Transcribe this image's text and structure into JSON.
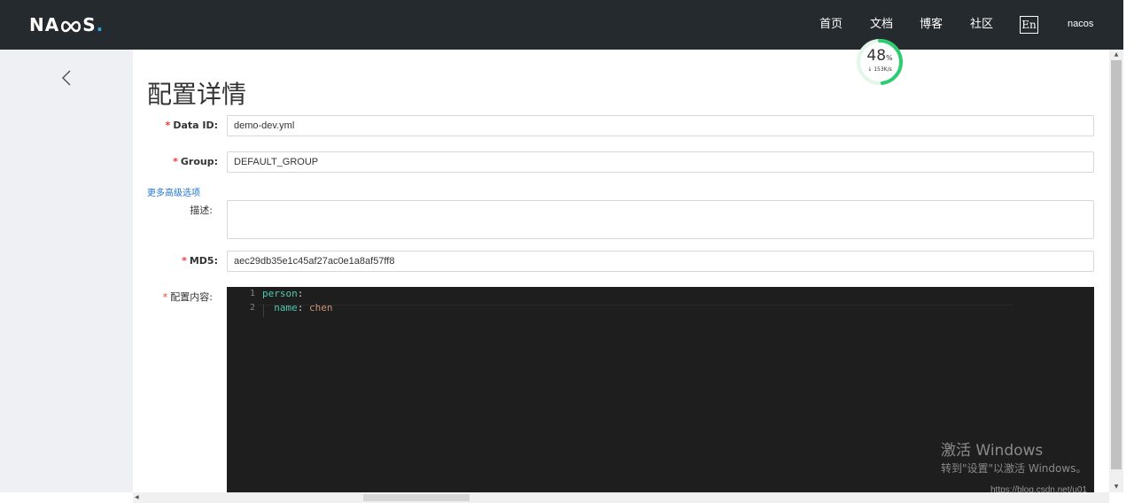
{
  "nav": {
    "logo_pre": "NA",
    "logo_post": "S",
    "logo_dot": ".",
    "items": [
      {
        "label": "首页"
      },
      {
        "label": "文档"
      },
      {
        "label": "博客"
      },
      {
        "label": "社区"
      }
    ],
    "lang": "En",
    "user": "nacos"
  },
  "page": {
    "title": "配置详情"
  },
  "form": {
    "data_id_label": "Data ID:",
    "data_id_value": "demo-dev.yml",
    "group_label": "Group:",
    "group_value": "DEFAULT_GROUP",
    "advanced_link": "更多高级选项",
    "desc_label": "描述:",
    "desc_value": "",
    "md5_label": "MD5:",
    "md5_value": "aec29db35e1c45af27ac0e1a8af57ff8",
    "content_label": "配置内容:",
    "required_mark": "*"
  },
  "editor": {
    "lines": [
      {
        "num": "1",
        "key": "person",
        "sep": ":",
        "value": ""
      },
      {
        "num": "2",
        "key": "  name",
        "sep": ": ",
        "value": "chen"
      }
    ]
  },
  "network_widget": {
    "percent": "48",
    "percent_unit": "%",
    "speed": "↓ 153K/s",
    "progress": 0.48
  },
  "watermark": {
    "title": "激活 Windows",
    "subtitle": "转到\"设置\"以激活 Windows。",
    "url": "https://blog.csdn.net/u01"
  },
  "colors": {
    "nav_bg": "#252a2f",
    "sidebar_bg": "#eef0f3",
    "editor_bg": "#1e1e1e",
    "required": "#ff3333",
    "link": "#2077d3",
    "widget_ring": "#2ecc71"
  }
}
